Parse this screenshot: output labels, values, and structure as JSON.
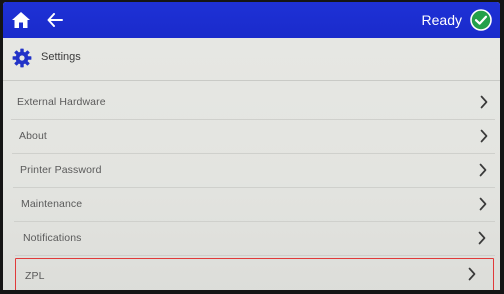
{
  "header": {
    "status_label": "Ready",
    "status_color": "#23a04a",
    "bar_color": "#1e31d6"
  },
  "icons": {
    "home": "home-icon",
    "back": "back-arrow-icon",
    "status": "check-circle-icon",
    "settings": "gear-icon",
    "row": "chevron-right-icon"
  },
  "settings": {
    "title": "Settings"
  },
  "menu": {
    "items": [
      {
        "label": "External Hardware"
      },
      {
        "label": "About"
      },
      {
        "label": "Printer Password"
      },
      {
        "label": "Maintenance"
      },
      {
        "label": "Notifications"
      },
      {
        "label": "ZPL",
        "selected": true
      }
    ]
  }
}
